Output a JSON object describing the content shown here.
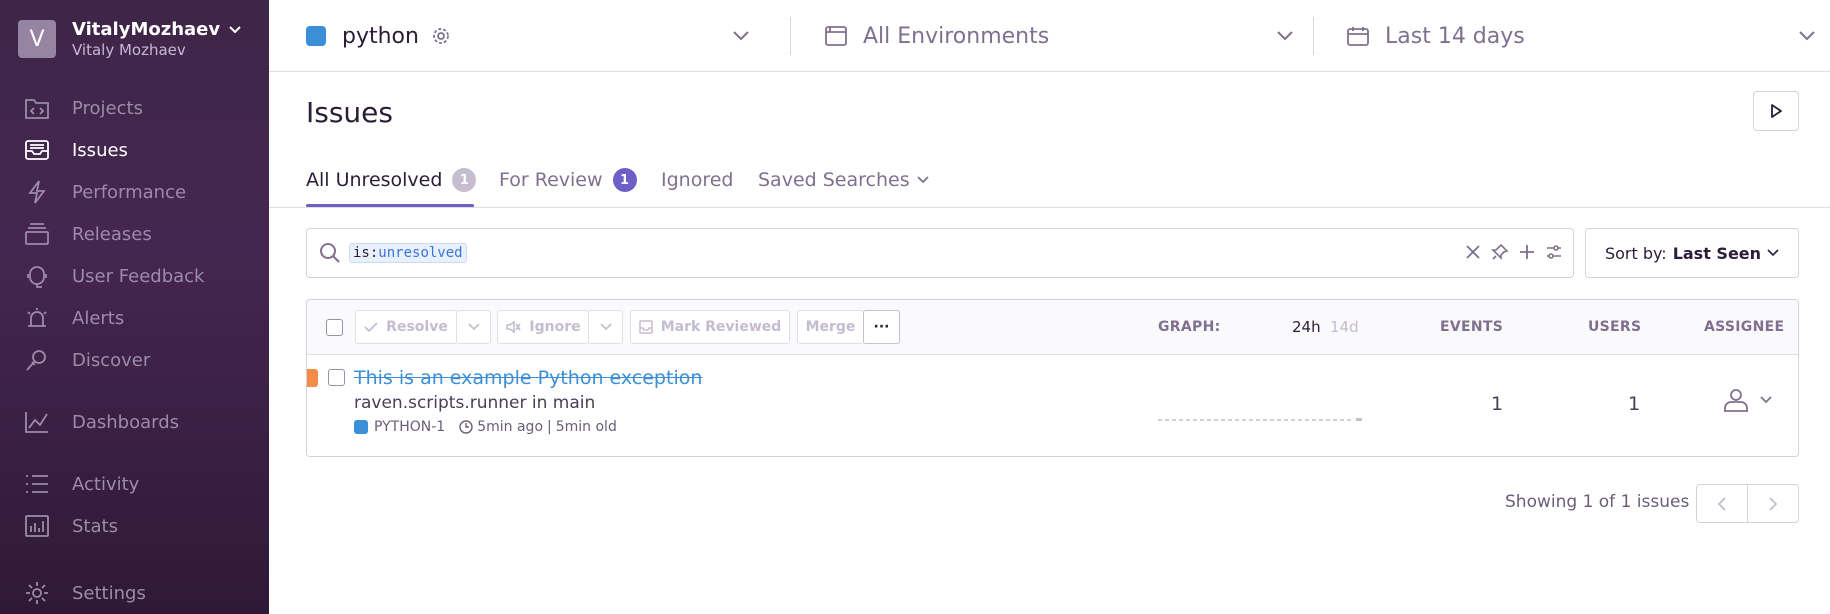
{
  "org": {
    "avatar_letter": "V",
    "name": "VitalyMozhaev",
    "user": "Vitaly Mozhaev"
  },
  "sidebar": {
    "items": [
      {
        "label": "Projects",
        "icon": "projects-icon"
      },
      {
        "label": "Issues",
        "icon": "issues-icon",
        "active": true
      },
      {
        "label": "Performance",
        "icon": "performance-icon"
      },
      {
        "label": "Releases",
        "icon": "releases-icon"
      },
      {
        "label": "User Feedback",
        "icon": "user-feedback-icon"
      },
      {
        "label": "Alerts",
        "icon": "alerts-icon"
      },
      {
        "label": "Discover",
        "icon": "discover-icon"
      },
      {
        "label": "Dashboards",
        "icon": "dashboards-icon"
      },
      {
        "label": "Activity",
        "icon": "activity-icon"
      },
      {
        "label": "Stats",
        "icon": "stats-icon"
      },
      {
        "label": "Settings",
        "icon": "settings-icon"
      }
    ]
  },
  "topbar": {
    "project": "python",
    "environment": "All Environments",
    "date_range": "Last 14 days"
  },
  "page": {
    "title": "Issues"
  },
  "tabs": [
    {
      "label": "All Unresolved",
      "count": "1"
    },
    {
      "label": "For Review",
      "count": "1"
    },
    {
      "label": "Ignored"
    },
    {
      "label": "Saved Searches"
    }
  ],
  "search": {
    "key": "is:",
    "value": "unresolved"
  },
  "sort": {
    "prefix": "Sort by:",
    "value": "Last Seen"
  },
  "actions": {
    "resolve": "Resolve",
    "ignore": "Ignore",
    "mark_reviewed": "Mark Reviewed",
    "merge": "Merge",
    "more": "···"
  },
  "columns": {
    "graph": "GRAPH:",
    "graph_24h": "24h",
    "graph_14d": "14d",
    "events": "EVENTS",
    "users": "USERS",
    "assignee": "ASSIGNEE"
  },
  "issues": [
    {
      "title": "This is an example Python exception",
      "culprit": "raven.scripts.runner in main",
      "short_id": "PYTHON-1",
      "last_seen": "5min ago",
      "separator": "|",
      "age": "5min old",
      "events": "1",
      "users": "1"
    }
  ],
  "footer": {
    "showing": "Showing 1 of 1 issues"
  },
  "colors": {
    "accent": "#6c5fc7",
    "link": "#3c8fd6",
    "level_warning": "#f58c46"
  }
}
